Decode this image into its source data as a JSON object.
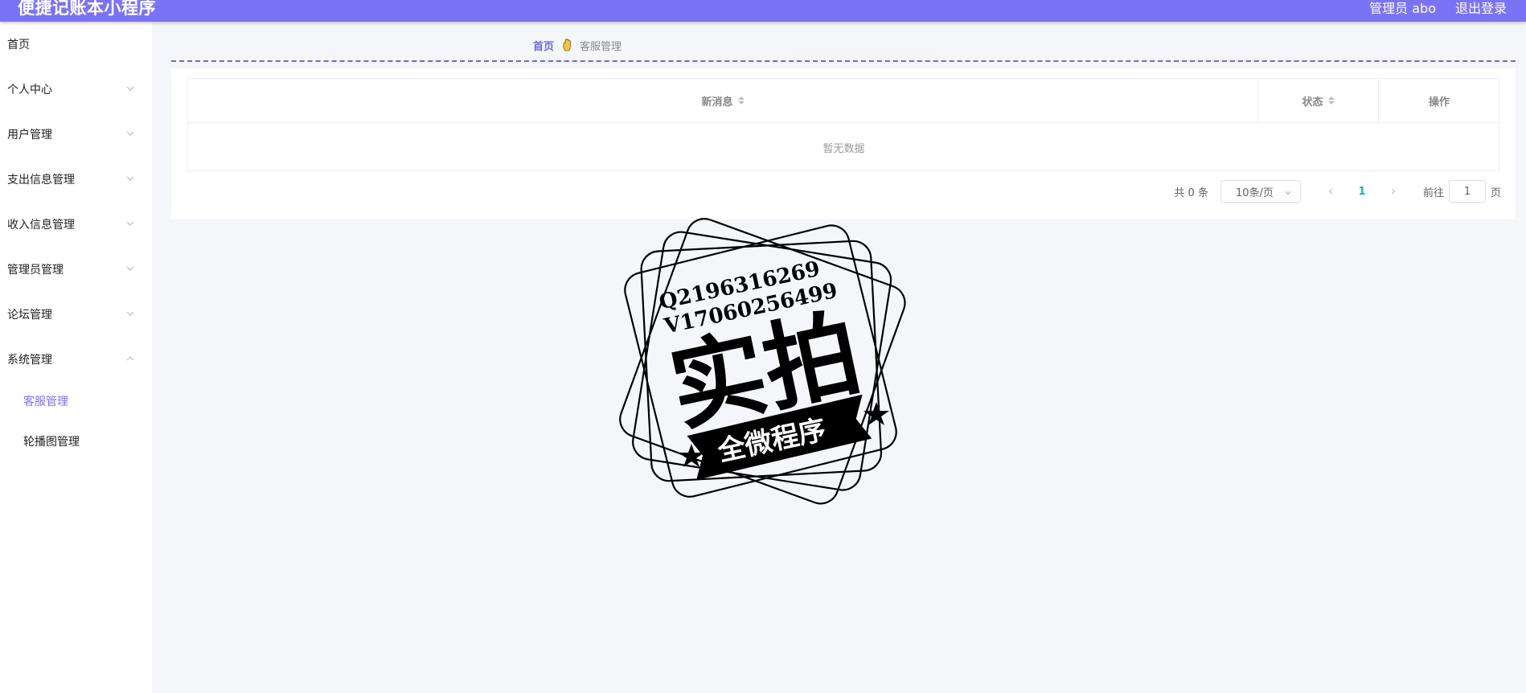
{
  "header": {
    "title": "便捷记账本小程序",
    "user_label": "管理员 abo",
    "logout_label": "退出登录",
    "bg_color": "#7b73f6"
  },
  "sidebar": {
    "items": [
      {
        "label": "首页",
        "icon": null
      },
      {
        "label": "个人中心",
        "icon": "chevron-down-icon"
      },
      {
        "label": "用户管理",
        "icon": "chevron-down-icon"
      },
      {
        "label": "支出信息管理",
        "icon": "chevron-down-icon"
      },
      {
        "label": "收入信息管理",
        "icon": "chevron-down-icon"
      },
      {
        "label": "管理员管理",
        "icon": "chevron-down-icon"
      },
      {
        "label": "论坛管理",
        "icon": "chevron-down-icon"
      },
      {
        "label": "系统管理",
        "icon": "chevron-up-icon"
      }
    ],
    "subitems": [
      {
        "label": "客服管理",
        "active": true
      },
      {
        "label": "轮播图管理",
        "active": false
      }
    ]
  },
  "breadcrumb": {
    "home": "首页",
    "separator_icon": "hand-icon",
    "current": "客服管理"
  },
  "table": {
    "columns": [
      {
        "label": "新消息",
        "sortable": true
      },
      {
        "label": "状态",
        "sortable": true
      },
      {
        "label": "操作",
        "sortable": false
      }
    ],
    "empty_text": "暂无数据"
  },
  "pagination": {
    "total": "共 0 条",
    "page_size": "10条/页",
    "current_page": "1",
    "jump_label": "前往",
    "jump_value": "1",
    "jump_unit": "页"
  },
  "watermark": {
    "line1": "Q2196316269",
    "line2": "V17060256499",
    "main": "实拍",
    "banner": "全微程序"
  },
  "colors": {
    "accent": "#7b73f6",
    "breadcrumb_home": "#6d68d8",
    "active_page": "#10b5a3"
  }
}
